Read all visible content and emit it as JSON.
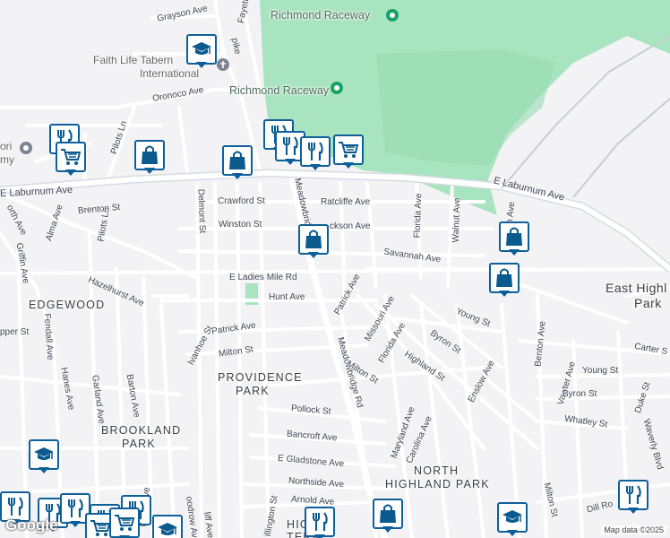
{
  "streets": {
    "grayson": "Grayson Ave",
    "fayette": "Fayette",
    "pike": "pike",
    "oronoco": "Oronoco Ave",
    "pilots1": "Pilots Ln",
    "pilots2": "Pilots Ln",
    "laburnum_w": "E Laburnum Ave",
    "laburnum_e": "E Laburnum Ave",
    "laburnum_far": "num Ave",
    "alma": "Alma Ave",
    "brenton": "Brenton St",
    "north": "orth Ave",
    "griffin": "Griffin Ave",
    "hazelhurst": "Hazelhurst Ave",
    "delmont": "Delmont St",
    "crawford": "Crawford St",
    "ratcliffe": "Ratcliffe Ave",
    "winston": "Winston St",
    "jackson": "ckson Ave",
    "meadowbridge_n": "Meadowbridge Rd",
    "meadowbridge_s": "Meadowbridge Rd",
    "florida_n": "Florida Ave",
    "walnut": "Walnut Ave",
    "savannah": "Savannah Ave",
    "ladies_mile": "E Ladies Mile Rd",
    "hunt": "Hunt Ave",
    "patrick_e": "Patrick Ave",
    "patrick_w": "Patrick Ave",
    "missouri": "Missouri Ave",
    "florida_s": "Florida Ave",
    "byron_n": "Byron St",
    "young_n": "Young St",
    "ivanhoe": "Ivanhoe St",
    "milton_w": "Milton St",
    "milton_c": "Milton St",
    "highland": "Highland St",
    "enslow": "Enslow Ave",
    "benton": "Benton Ave",
    "carter": "Carter S",
    "vawter": "Vawter Ave",
    "young_e": "Young St",
    "byron_e": "Byron St",
    "duke": "Duke St",
    "whatley": "Whatley St",
    "fendall": "Fendall Ave",
    "hanes": "Hanes Ave",
    "garland": "Garland Ave",
    "barton": "Barton Ave",
    "pepper": "pper St",
    "pollock": "Pollock St",
    "bancroft": "Bancroft Ave",
    "gladstone": "E Gladstone Ave",
    "northside": "Northside Ave",
    "arnold": "Arnold Ave",
    "maryland": "Maryland Ave",
    "carolina": "Carolina Ave",
    "milton_se": "Milton St",
    "waverly": "Waverly Blvd",
    "lamb": "Lamb Ave",
    "woodrow": "oodrow Ave",
    "cliff": "liff Ave",
    "illington": "illington St",
    "dill": "Dill Ro",
    "florida_far": "n Ave"
  },
  "neighborhoods": {
    "edgewood": "EDGEWOOD",
    "providence_1": "PROVIDENCE",
    "providence_2": "PARK",
    "brookland_1": "BROOKLAND",
    "brookland_2": "PARK",
    "north_highland_1": "NORTH",
    "north_highland_2": "HIGHLAND PARK",
    "east_highland_1": "East Highl",
    "east_highland_2": "Park",
    "highland_te_1": "HIGHL",
    "highland_te_2": "TERR"
  },
  "pois": {
    "raceway_1": "Richmond Raceway",
    "raceway_2": "Richmond Raceway",
    "faith_1": "Faith Life Tabern",
    "faith_2": "International",
    "mori_1": "ori",
    "mori_2": "my"
  },
  "attribution": {
    "google": "Google",
    "mapdata": "Map data ©2025"
  },
  "markers": [
    {
      "name": "school-marker",
      "icon": "school"
    },
    {
      "name": "restaurant-marker",
      "icon": "restaurant"
    },
    {
      "name": "shopping-bag-marker",
      "icon": "bag"
    },
    {
      "name": "grocery-cart-marker",
      "icon": "cart"
    }
  ],
  "colors": {
    "park": "#a8e4bf",
    "marker_border": "#0d5f9a",
    "marker_fill": "#0b5a8e",
    "poi_green": "#19a265",
    "poi_gray": "#7d8490"
  }
}
